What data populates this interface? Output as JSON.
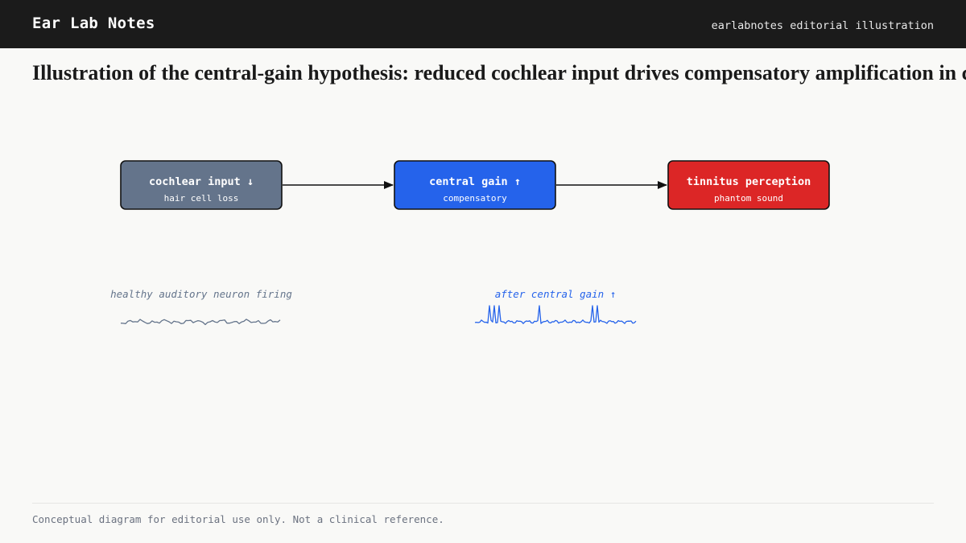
{
  "header": {
    "brand": "Ear Lab Notes",
    "tagline": "earlabnotes editorial illustration"
  },
  "headline": "Illustration of the central-gain hypothesis: reduced cochlear input drives compensatory amplification in central auditory pathways",
  "diagram": {
    "nodes": [
      {
        "title": "cochlear input ↓",
        "subtitle": "hair cell loss",
        "color": "#64748b"
      },
      {
        "title": "central gain ↑",
        "subtitle": "compensatory",
        "color": "#2563eb"
      },
      {
        "title": "tinnitus perception",
        "subtitle": "phantom sound",
        "color": "#dc2626"
      }
    ],
    "edges": [
      {
        "from": "cochlear input ↓",
        "to": "central gain ↑"
      },
      {
        "from": "central gain ↑",
        "to": "tinnitus perception"
      }
    ],
    "traces": [
      {
        "label": "healthy auditory neuron firing",
        "color": "#64748b",
        "pattern": "low-amplitude irregular noise"
      },
      {
        "label": "after central gain ↑",
        "color": "#2563eb",
        "pattern": "baseline with intermittent tall spikes"
      }
    ]
  },
  "footer": {
    "note": "Conceptual diagram for editorial use only. Not a clinical reference."
  }
}
